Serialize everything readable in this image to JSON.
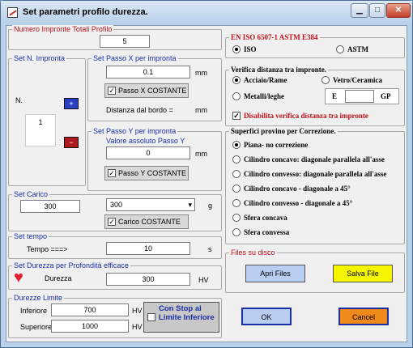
{
  "window": {
    "title": "Set parametri profilo durezza."
  },
  "impronte": {
    "label": "Numero Impronte Totali Profilo",
    "value": "5"
  },
  "n_impronta": {
    "label": "Set N. Impronta",
    "n_label": "N.",
    "value": "1"
  },
  "passo_x": {
    "label": "Set Passo X per impronta",
    "value": "0.1",
    "unit": "mm",
    "costante_label": "Passo X COSTANTE",
    "distanza_label": "Distanza dal bordo =",
    "distanza_unit": "mm"
  },
  "passo_y": {
    "label": "Set Passo Y per impronta",
    "sublabel": "Valore assoluto Passo Y",
    "value": "0",
    "unit": "mm",
    "costante_label": "Passo Y COSTANTE"
  },
  "carico": {
    "label": "Set Carico",
    "value": "300",
    "select_value": "300",
    "unit": "g",
    "costante_label": "Carico COSTANTE"
  },
  "tempo": {
    "label": "Set tempo",
    "field_label": "Tempo ===>",
    "value": "10",
    "unit": "s"
  },
  "durezza": {
    "label": "Set Durezza per Profondità efficace",
    "field_label": "Durezza",
    "value": "300",
    "unit": "HV"
  },
  "limiti": {
    "label": "Durezze Limite",
    "inferiore_label": "Inferiore",
    "inferiore_value": "700",
    "superiore_label": "Superiore",
    "superiore_value": "1000",
    "unit": "HV",
    "stop_label": "Con Stop al Limite Inferiore"
  },
  "standard": {
    "label": "EN ISO 6507-1   ASTM E384",
    "options": [
      "ISO",
      "ASTM"
    ],
    "selected": "ISO"
  },
  "verifica": {
    "label": "Verifica distanza tra impronte.",
    "options": [
      "Acciaio/Rame",
      "Vetro/Ceramica",
      "Metalli/leghe"
    ],
    "e_label": "E",
    "gp_label": "GP",
    "disabilita_label": "Disabilita verifica distanza tra impronte"
  },
  "superfici": {
    "label": "Superfici provino per Correzione.",
    "options": [
      "Piana- no correzione",
      "Cilindro concavo: diagonale parallela all'asse",
      "Cilindro convesso: diagonale parallela all'asse",
      "Cilindro concavo - diagonale a 45°",
      "Cilindro convesso - diagonale a 45°",
      "Sfera concava",
      "Sfera convessa"
    ]
  },
  "files": {
    "label": "Files su disco",
    "apri_label": "Apri Files",
    "salva_label": "Salva File"
  },
  "actions": {
    "ok_label": "OK",
    "cancel_label": "Cancel"
  },
  "colors": {
    "label_red": "#c0101a",
    "label_blue": "#1a2fa3",
    "heart": "#e02030",
    "save_yellow": "#f5f500",
    "cancel_orange": "#f08a1a",
    "open_blue": "#b8cdf0"
  }
}
